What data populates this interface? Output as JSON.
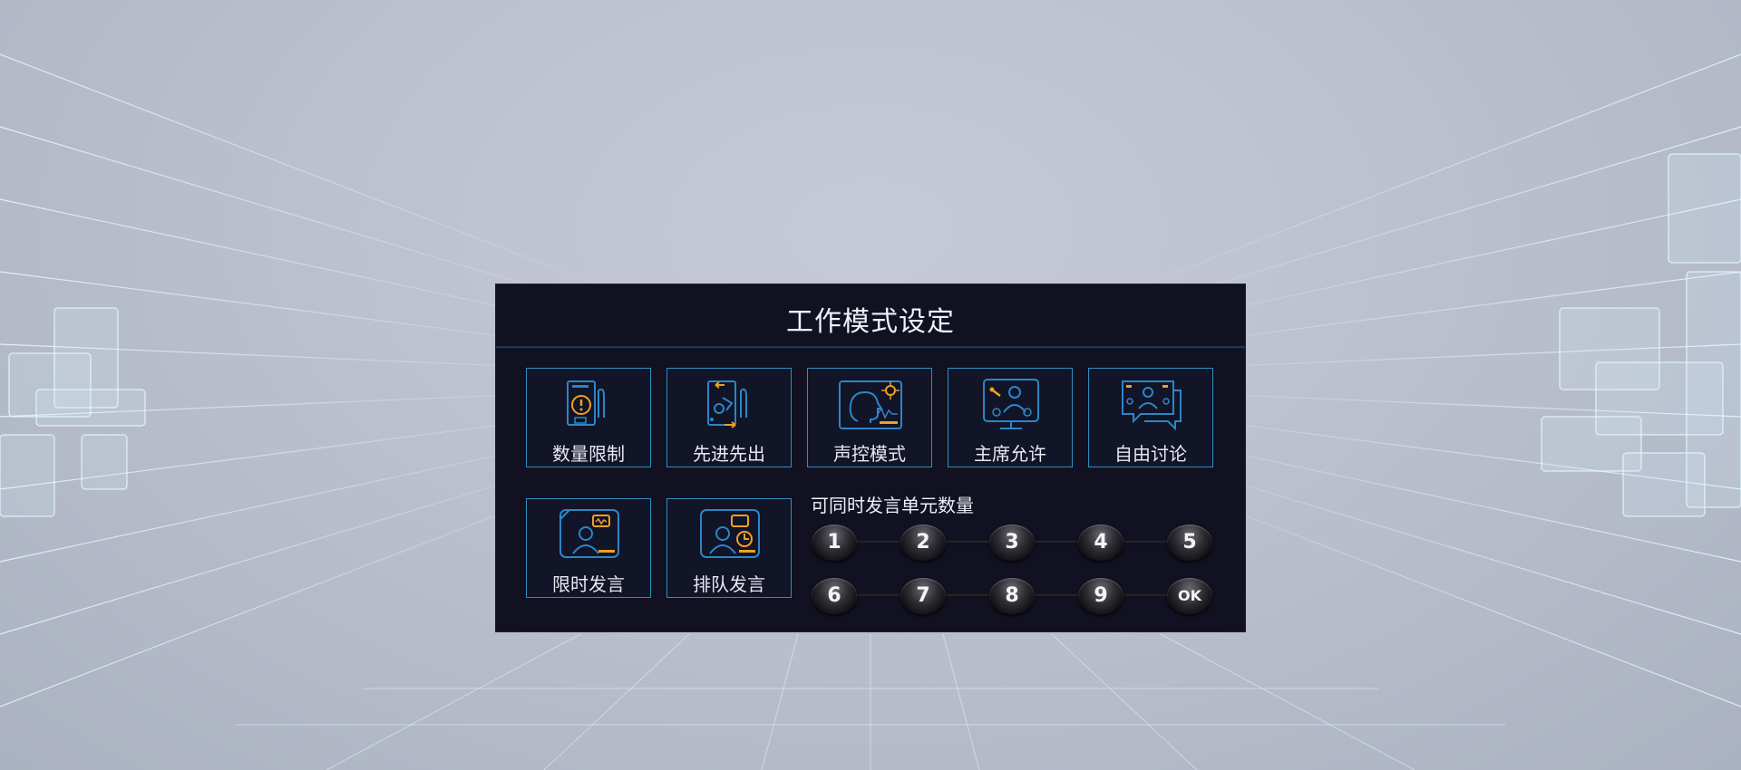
{
  "panel": {
    "title": "工作模式设定"
  },
  "modes_row1": [
    {
      "label": "数量限制",
      "icon": "quantity-limit-icon"
    },
    {
      "label": "先进先出",
      "icon": "first-in-first-out-icon"
    },
    {
      "label": "声控模式",
      "icon": "voice-control-icon"
    },
    {
      "label": "主席允许",
      "icon": "chairman-approval-icon"
    },
    {
      "label": "自由讨论",
      "icon": "free-discussion-icon"
    }
  ],
  "modes_row2": [
    {
      "label": "限时发言",
      "icon": "timed-speech-icon"
    },
    {
      "label": "排队发言",
      "icon": "queued-speech-icon"
    }
  ],
  "speaker_count": {
    "label": "可同时发言单元数量",
    "row1": [
      "1",
      "2",
      "3",
      "4",
      "5"
    ],
    "row2": [
      "6",
      "7",
      "8",
      "9",
      "OK"
    ]
  },
  "colors": {
    "panel_bg": "#111122",
    "border_accent": "#2e8fbd",
    "icon_orange": "#f0a020",
    "icon_blue": "#2c86c8"
  }
}
